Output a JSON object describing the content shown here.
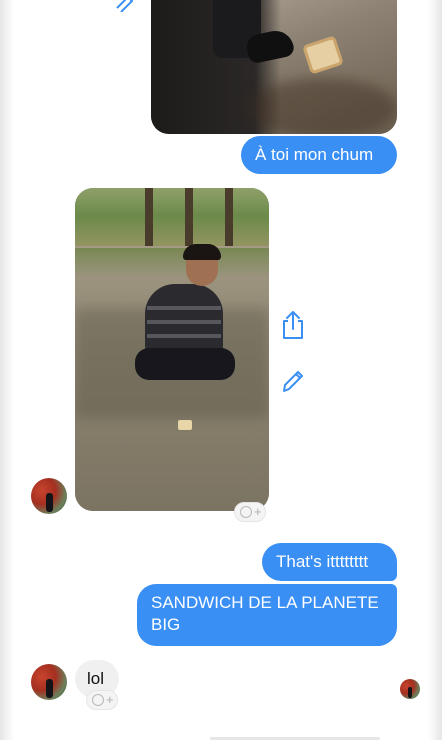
{
  "messages": {
    "sent_1": "À toi mon chum",
    "sent_2": "That's itttttttt",
    "sent_3": "SANDWICH DE LA PLANETE BIG",
    "received_1": "lol"
  },
  "icons": {
    "share": "share-icon",
    "edit": "pencil-icon",
    "reaction": "add-reaction-icon"
  },
  "colors": {
    "sent_bubble": "#3a8ff5",
    "received_bubble": "#f0f0f0",
    "accent": "#3a8ff5"
  }
}
